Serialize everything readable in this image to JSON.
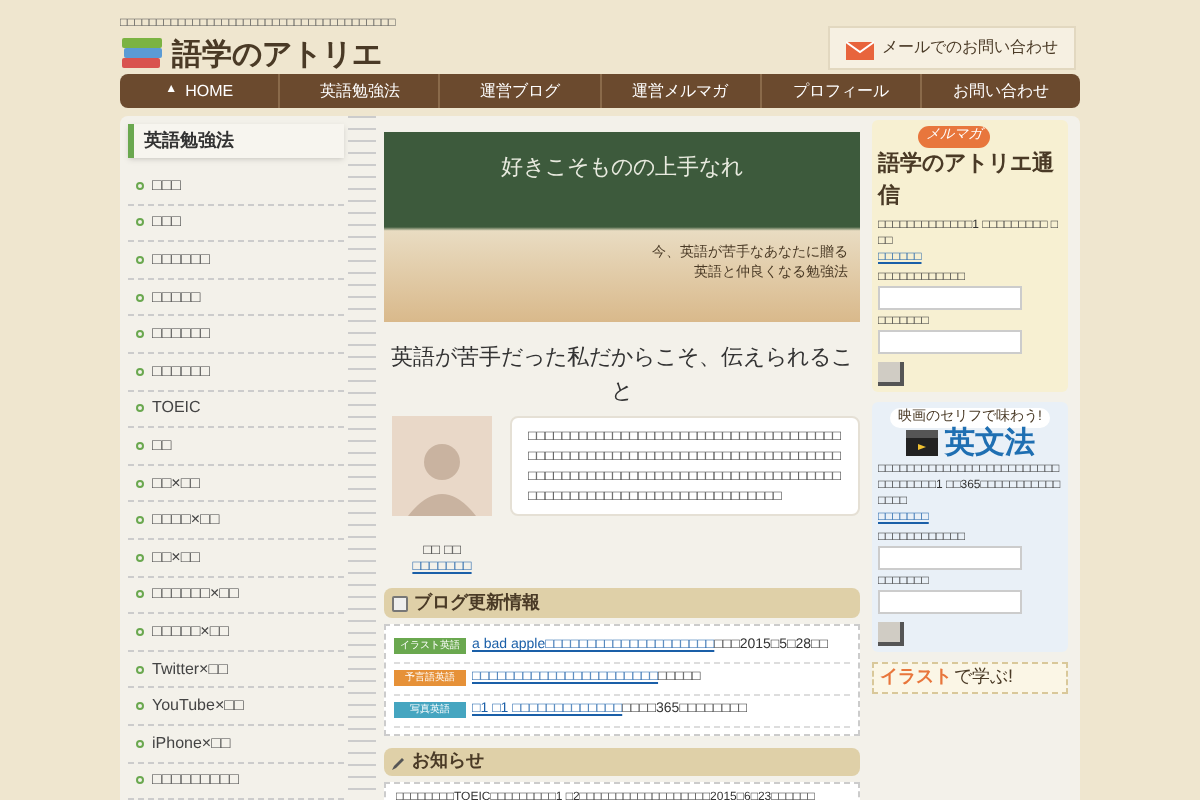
{
  "site": {
    "tagline": "□□□□□□□□□□□□□□□□□□□□□□□□□□□□□□□□□□□□□□",
    "logo": "語学のアトリエ",
    "contact_button": "メールでのお問い合わせ"
  },
  "nav": [
    {
      "label": "HOME",
      "icon": "▲"
    },
    {
      "label": "英語勉強法"
    },
    {
      "label": "運営ブログ"
    },
    {
      "label": "運営メルマガ"
    },
    {
      "label": "プロフィール"
    },
    {
      "label": "お問い合わせ"
    }
  ],
  "sidebar": {
    "title": "英語勉強法",
    "items": [
      "□□□",
      "□□□",
      "□□□□□□",
      "□□□□□",
      "□□□□□□",
      "□□□□□□",
      "TOEIC",
      "□□",
      "□□×□□",
      "□□□□×□□",
      "□□×□□",
      "□□□□□□×□□",
      "□□□□□×□□",
      "Twitter×□□",
      "YouTube×□□",
      "iPhone×□□",
      "□□□□□□□□□"
    ]
  },
  "banner": {
    "headline": "好きこそものの上手なれ",
    "caption_lines": [
      "今、英語が苦手なあなたに贈る",
      "英語と仲良くなる勉強法"
    ]
  },
  "intro": {
    "heading": "英語が苦手だった私だからこそ、伝えられること",
    "body": "□□□□□□□□□□□□□□□□□□□□□□□□□□□□□□□□□□□□□□□□□□□□□□□□□□□□□□□□□□□□□□□□□□□□□□□□□□□□□□□□□□□□□□□□□□□□□□□□□□□□□□□□□□□□□□□□□□□□□□□□□□□□□□□□□□□□□□□□□□□□□",
    "name": "□□ □□",
    "profile_link": "□□□□□□□"
  },
  "blog": {
    "title": "ブログ更新情報",
    "entries": [
      {
        "tag": "イラスト英語",
        "color": "#6aa84f",
        "link": "a bad apple□□□□□□□□□□□□□□□□□□□□",
        "text": "□□□2015□5□28□□"
      },
      {
        "tag": "予言語英語",
        "color": "#e69138",
        "link": "□□□□□□□□□□□□□□□□□□□□□□",
        "text": "□□□□□"
      },
      {
        "tag": "写真英語",
        "color": "#45a5c0",
        "link": "□1 □1 □□□□□□□□□□□□□",
        "text": "□□□□365□□□□□□□□"
      }
    ]
  },
  "news": {
    "title": "お知らせ",
    "text": "□□□□□□□□TOEIC□□□□□□□□□1 □2□□□□□□□□□□□□□□□□□□2015□6□23□□□□□□"
  },
  "right": [
    {
      "kind": "mail",
      "badge": "メルマガ",
      "title": "語学のアトリエ通信",
      "text": "□□□□□□□□□□□□□1 □□□□□□□□□ □□□",
      "link": "□□□□□□",
      "fields": [
        "□□□□□□□□□□□□",
        "□□□□□□□"
      ]
    },
    {
      "kind": "movie",
      "badge": "映画のセリフで味わう!",
      "title": "英文法",
      "text": "□□□□□□□□□□□□□□□□□□□□□□□□□□□□□□□□□1 □□365□□□□□□□□□□□□□□□",
      "link": "□□□□□□□",
      "fields": [
        "□□□□□□□□□□□□",
        "□□□□□□□"
      ]
    },
    {
      "kind": "illust",
      "badge": "イラスト",
      "title": "で学ぶ!"
    }
  ]
}
